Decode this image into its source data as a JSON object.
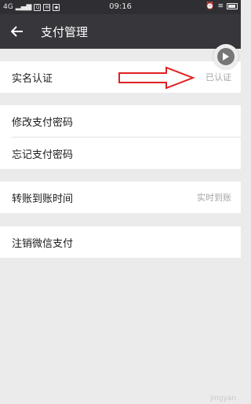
{
  "status_bar": {
    "network": "4G",
    "signal": "ull",
    "icons": [
      "qq-icon",
      "message-icon",
      "android-icon"
    ],
    "time": "09:16"
  },
  "header": {
    "title": "支付管理",
    "back_icon": "back-arrow-icon"
  },
  "groups": [
    {
      "rows": [
        {
          "label": "实名认证",
          "value": "已认证"
        }
      ]
    },
    {
      "rows": [
        {
          "label": "修改支付密码",
          "value": ""
        },
        {
          "label": "忘记支付密码",
          "value": ""
        }
      ]
    },
    {
      "rows": [
        {
          "label": "转账到账时间",
          "value": "实时到账"
        }
      ]
    },
    {
      "rows": [
        {
          "label": "注销微信支付",
          "value": ""
        }
      ]
    }
  ],
  "overlay": {
    "arrow_color": "#e02020",
    "floating_button_icon": "play-icon"
  },
  "watermark": "jingyan"
}
